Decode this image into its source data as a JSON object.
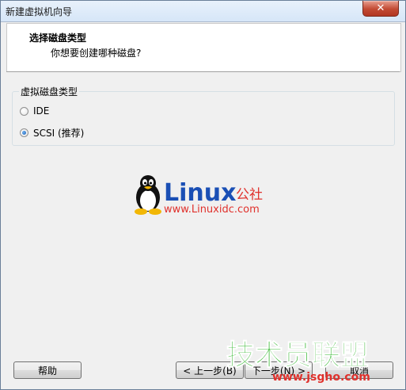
{
  "window": {
    "title": "新建虚拟机向导",
    "close_label": "✕"
  },
  "header": {
    "title": "选择磁盘类型",
    "subtitle": "你想要创建哪种磁盘?"
  },
  "disk_type": {
    "group_label": "虚拟磁盘类型",
    "options": [
      {
        "label": "IDE",
        "selected": false
      },
      {
        "label": "SCSI (推荐)",
        "selected": true
      }
    ]
  },
  "watermarks": {
    "linux_name": "Linux",
    "linux_suffix": "公社",
    "linux_url": "www.Linuxidc.com",
    "jsgho_name": "技术员联盟",
    "jsgho_url": "www.jsgho.com"
  },
  "buttons": {
    "help": "帮助",
    "back": "< 上一步(B)",
    "next": "下一步(N) >",
    "cancel": "取消"
  },
  "colors": {
    "linux_blue": "#1a4fb5",
    "linux_red": "#e0312c",
    "jsgho_green": "#2fb52a"
  }
}
